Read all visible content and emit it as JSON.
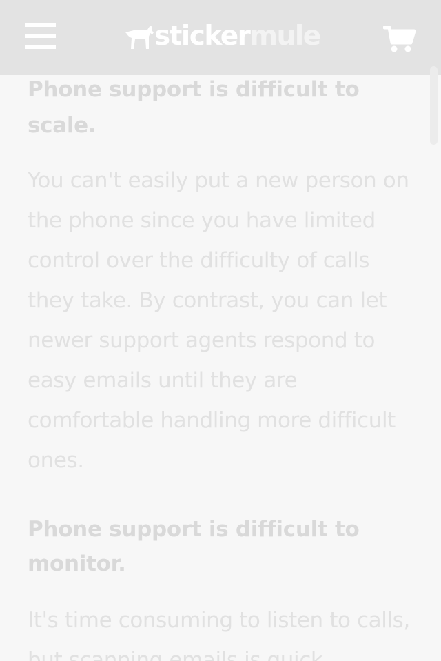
{
  "header": {
    "logo_left": "sticker",
    "logo_right": "mule",
    "menu_icon": "hamburger-menu-icon",
    "cart_icon": "shopping-cart-icon",
    "brand_color": "#ffffff",
    "bar_color": "#e3e3e3"
  },
  "article": {
    "sections": [
      {
        "heading": "Phone support is difficult to scale.",
        "body": "You can't easily put a new person on the phone since you have limited control over the difficulty of calls they take. By contrast, you can let newer support agents respond to easy emails until they are comfortable handling more difficult ones."
      },
      {
        "heading": "Phone support is difficult to monitor.",
        "body": "It's time consuming to listen to calls, but scanning emails is quick"
      }
    ]
  }
}
